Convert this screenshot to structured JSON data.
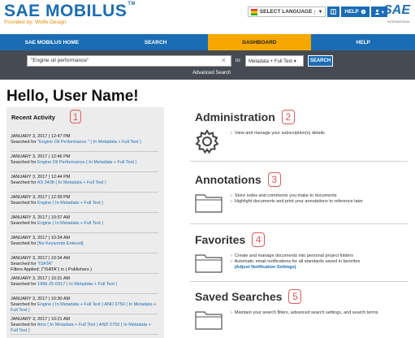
{
  "header": {
    "logo_text": "SAE MOBILUS",
    "logo_tm": "TM",
    "logo_sub": "Provided by: Wolfe Design",
    "language_label": "SELECT LANGUAGE",
    "language_arrow": "▼",
    "help_label": "HELP",
    "user_menu": "▾",
    "sae_mark": "SAE",
    "sae_mark_sub": "INTERNATIONAL"
  },
  "nav": {
    "items": [
      {
        "label": "SAE MOBILUS HOME",
        "active": false
      },
      {
        "label": "SEARCH",
        "active": false
      },
      {
        "label": "DASHBOARD",
        "active": true
      },
      {
        "label": "HELP",
        "active": false
      }
    ]
  },
  "search": {
    "query": "\"Engine oil performance\"",
    "in_label": "in:",
    "scope": "Metadata + Full Text",
    "scope_arrow": "▾",
    "button_label": "SEARCH",
    "advanced_label": "Advanced Search"
  },
  "main": {
    "greeting": "Hello, User Name!"
  },
  "recent_activity": {
    "title": "Recent Activity",
    "badge": "1",
    "items": [
      {
        "date": "JANUARY 3, 2017 | 12:47 PM",
        "lines": [
          [
            "Searched for ",
            "\"Engine Oil Performance \" ( In Metadata + Full Text )"
          ]
        ]
      },
      {
        "date": "JANUARY 3, 2017 | 12:46 PM",
        "lines": [
          [
            "Searched for ",
            "Engine Oil Performance ( In Metadata + Full Text )"
          ]
        ]
      },
      {
        "date": "JANUARY 3, 2017 | 12:44 PM",
        "lines": [
          [
            "Searched for ",
            "AS 3408 ( In Metadata + Full Text )"
          ]
        ]
      },
      {
        "date": "JANUARY 3, 2017 | 12:39 PM",
        "lines": [
          [
            "Searched for ",
            "Engine ( In Metadata + Full Text )"
          ]
        ]
      },
      {
        "date": "JANUARY 3, 2017 | 10:37 AM",
        "lines": [
          [
            "Searched for ",
            "Engine ( In Metadata + Full Text )"
          ]
        ]
      },
      {
        "date": "JANUARY 3, 2017 | 10:34 AM",
        "lines": [
          [
            "Searched for ",
            "[No Keywords Entered]"
          ]
        ]
      },
      {
        "date": "JANUARY 3, 2017 | 10:34 AM",
        "lines": [
          [
            "Searched for ",
            "\"ISATA\""
          ],
          [
            "Filters Applied: (\"ISATA\") in ( Publishers )",
            ""
          ]
        ]
      },
      {
        "date": "JANUARY 3, 2017 | 10:31 AM",
        "lines": [
          [
            "Searched for ",
            "1996-25-0317 ( In Metadata + Full Text )"
          ]
        ]
      },
      {
        "date": "JANUARY 3, 2017 | 10:30 AM",
        "lines": [
          [
            "Searched for ",
            "Engine ( In Metadata + Full Text ) AND 2750 ( In Metadata + Full Text )"
          ]
        ]
      },
      {
        "date": "JANUARY 3, 2017 | 10:21 AM",
        "lines": [
          [
            "Searched for ",
            "Ams ( In Metadata + Full Text ) AND 2750 ( In Metadata + Full Text )"
          ]
        ]
      }
    ]
  },
  "sections": [
    {
      "key": "administration",
      "title": "Administration",
      "badge": "2",
      "icon": "gear-icon",
      "lines": [
        {
          "text": "View and manage your subscription(s) details",
          "link": ""
        }
      ]
    },
    {
      "key": "annotations",
      "title": "Annotations",
      "badge": "3",
      "icon": "folder-icon",
      "lines": [
        {
          "text": "Store notes and comments you make to documents",
          "link": ""
        },
        {
          "text": "Highlight documents and print your annotations to reference later",
          "link": ""
        }
      ]
    },
    {
      "key": "favorites",
      "title": "Favorites",
      "badge": "4",
      "icon": "folder-icon",
      "lines": [
        {
          "text": "Create and manage documents into personal project folders",
          "link": ""
        },
        {
          "text": "Automatic email notifications for all standards saved in favorites",
          "link": "(Adjust Notification Settings)"
        }
      ]
    },
    {
      "key": "saved_searches",
      "title": "Saved Searches",
      "badge": "5",
      "icon": "folder-icon",
      "lines": [
        {
          "text": "Maintain your search filters, advanced search settings, and search terms",
          "link": ""
        }
      ]
    }
  ],
  "colors": {
    "brand_blue": "#1a6db5",
    "accent_orange": "#f7a800",
    "badge_red": "#e05a5a",
    "search_band": "#464a52"
  }
}
